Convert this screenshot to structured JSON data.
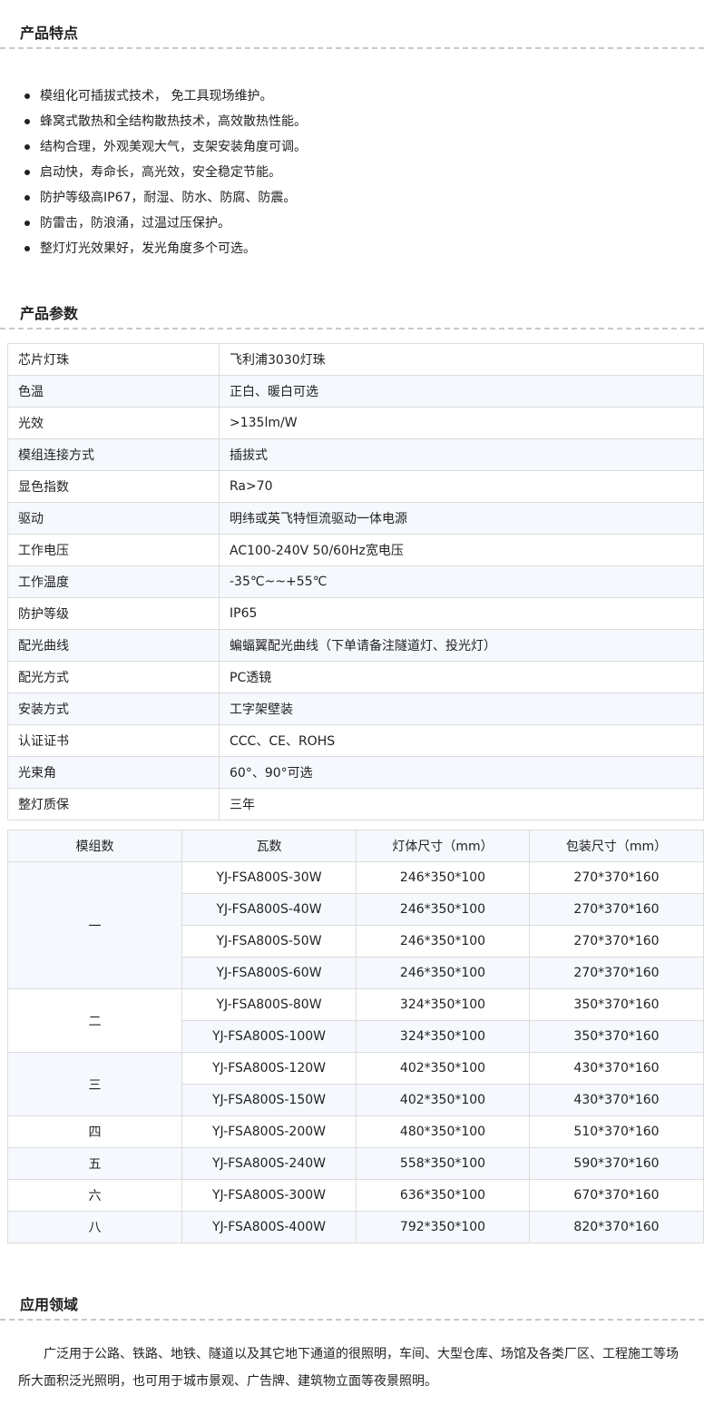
{
  "features": {
    "title": "产品特点",
    "items": [
      "模组化可插拔式技术， 免工具现场维护。",
      "蜂窝式散热和全结构散热技术，高效散热性能。",
      "结构合理，外观美观大气，支架安装角度可调。",
      "启动快，寿命长，高光效，安全稳定节能。",
      "防护等级高IP67，耐湿、防水、防腐、防震。",
      "防雷击，防浪涌，过温过压保护。",
      "整灯灯光效果好，发光角度多个可选。"
    ]
  },
  "params": {
    "title": "产品参数",
    "rows": [
      {
        "label": "芯片灯珠",
        "value": "飞利浦3030灯珠"
      },
      {
        "label": "色温",
        "value": "正白、暖白可选"
      },
      {
        "label": "光效",
        "value": ">135lm/W"
      },
      {
        "label": "模组连接方式",
        "value": "插拔式"
      },
      {
        "label": "显色指数",
        "value": "Ra>70"
      },
      {
        "label": "驱动",
        "value": "明纬或英飞特恒流驱动一体电源"
      },
      {
        "label": "工作电压",
        "value": "AC100-240V 50/60Hz宽电压"
      },
      {
        "label": "工作温度",
        "value": "-35℃~~+55℃"
      },
      {
        "label": "防护等级",
        "value": "IP65"
      },
      {
        "label": "配光曲线",
        "value": "蝙蝠翼配光曲线（下单请备注隧道灯、投光灯）"
      },
      {
        "label": "配光方式",
        "value": "PC透镜"
      },
      {
        "label": "安装方式",
        "value": "工字架壁装"
      },
      {
        "label": "认证证书",
        "value": "CCC、CE、ROHS"
      },
      {
        "label": "光束角",
        "value": "60°、90°可选"
      },
      {
        "label": "整灯质保",
        "value": "三年"
      }
    ]
  },
  "models": {
    "headers": [
      "模组数",
      "瓦数",
      "灯体尺寸（mm）",
      "包装尺寸（mm）"
    ],
    "groups": [
      {
        "modules": "一",
        "rows": [
          {
            "watt": "YJ-FSA800S-30W",
            "body": "246*350*100",
            "pack": "270*370*160"
          },
          {
            "watt": "YJ-FSA800S-40W",
            "body": "246*350*100",
            "pack": "270*370*160"
          },
          {
            "watt": "YJ-FSA800S-50W",
            "body": "246*350*100",
            "pack": "270*370*160"
          },
          {
            "watt": "YJ-FSA800S-60W",
            "body": "246*350*100",
            "pack": "270*370*160"
          }
        ]
      },
      {
        "modules": "二",
        "rows": [
          {
            "watt": "YJ-FSA800S-80W",
            "body": "324*350*100",
            "pack": "350*370*160"
          },
          {
            "watt": "YJ-FSA800S-100W",
            "body": "324*350*100",
            "pack": "350*370*160"
          }
        ]
      },
      {
        "modules": "三",
        "rows": [
          {
            "watt": "YJ-FSA800S-120W",
            "body": "402*350*100",
            "pack": "430*370*160"
          },
          {
            "watt": "YJ-FSA800S-150W",
            "body": "402*350*100",
            "pack": "430*370*160"
          }
        ]
      },
      {
        "modules": "四",
        "rows": [
          {
            "watt": "YJ-FSA800S-200W",
            "body": "480*350*100",
            "pack": "510*370*160"
          }
        ]
      },
      {
        "modules": "五",
        "rows": [
          {
            "watt": "YJ-FSA800S-240W",
            "body": "558*350*100",
            "pack": "590*370*160"
          }
        ]
      },
      {
        "modules": "六",
        "rows": [
          {
            "watt": "YJ-FSA800S-300W",
            "body": "636*350*100",
            "pack": "670*370*160"
          }
        ]
      },
      {
        "modules": "八",
        "rows": [
          {
            "watt": "YJ-FSA800S-400W",
            "body": "792*350*100",
            "pack": "820*370*160"
          }
        ]
      }
    ]
  },
  "applications": {
    "title": "应用领域",
    "text": "广泛用于公路、铁路、地铁、隧道以及其它地下通道的很照明，车间、大型仓库、场馆及各类厂区、工程施工等场所大面积泛光照明，也可用于城市景观、广告牌、建筑物立面等夜景照明。"
  }
}
